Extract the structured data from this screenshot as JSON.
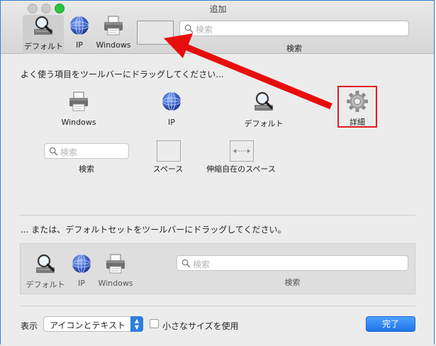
{
  "window": {
    "title": "追加"
  },
  "toolbar": {
    "items": [
      {
        "label": "デフォルト",
        "icon": "magnifier-icon"
      },
      {
        "label": "IP",
        "icon": "globe-icon"
      },
      {
        "label": "Windows",
        "icon": "printer-icon"
      }
    ],
    "search_placeholder": "検索",
    "search_label": "検索"
  },
  "palette": {
    "instruction": "よく使う項目をツールバーにドラッグしてください...",
    "items": [
      {
        "label": "Windows",
        "icon": "printer-icon"
      },
      {
        "label": "IP",
        "icon": "globe-icon"
      },
      {
        "label": "デフォルト",
        "icon": "magnifier-icon"
      },
      {
        "label": "詳細",
        "icon": "gear-icon"
      }
    ],
    "search_label": "検索",
    "search_placeholder": "検索",
    "space_label": "スペース",
    "flex_space_label": "伸縮自在のスペース"
  },
  "default_set": {
    "instruction": "... または、デフォルトセットをツールバーにドラッグしてください。",
    "items": [
      {
        "label": "デフォルト",
        "icon": "magnifier-icon"
      },
      {
        "label": "IP",
        "icon": "globe-icon"
      },
      {
        "label": "Windows",
        "icon": "printer-icon"
      }
    ],
    "search_placeholder": "検索",
    "search_label": "検索"
  },
  "bottom": {
    "show_label": "表示",
    "show_value": "アイコンとテキスト",
    "small_size_label": "小さなサイズを使用",
    "small_size_checked": false,
    "done_label": "完了"
  },
  "colors": {
    "accent": "#2f7fe0",
    "highlight": "#e21d1d",
    "arrow": "#e80d0d",
    "traffic_max": "#2dc33d"
  }
}
